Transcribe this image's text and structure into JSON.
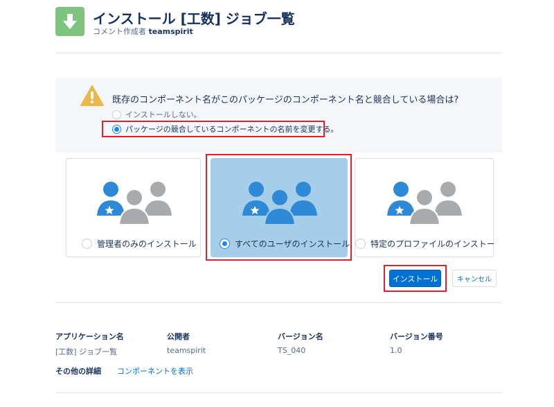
{
  "header": {
    "title": "インストール [工数] ジョブ一覧",
    "subtitle_prefix": "コメント作成者",
    "subtitle_author": "teamspirit"
  },
  "conflict": {
    "question": "既存のコンポーネント名がこのパッケージのコンポーネント名と競合している場合は?",
    "option_no_install": "インストールしない。",
    "option_rename": "パッケージの競合しているコンポーネントの名前を変更する。",
    "selected": "rename"
  },
  "install_options": [
    {
      "label": "管理者のみのインストール",
      "selected": false
    },
    {
      "label": "すべてのユーザのインストール",
      "selected": true
    },
    {
      "label": "特定のプロファイルのインストール...",
      "selected": false
    }
  ],
  "buttons": {
    "install": "インストール",
    "cancel": "キャンセル"
  },
  "details": {
    "columns": [
      {
        "header": "アプリケーション名",
        "value": "[工数] ジョブ一覧"
      },
      {
        "header": "公開者",
        "value": "teamspirit"
      },
      {
        "header": "バージョン名",
        "value": "TS_040"
      },
      {
        "header": "バージョン番号",
        "value": "1.0"
      }
    ],
    "more_label": "その他の詳細",
    "more_link": "コンポーネントを表示"
  },
  "colors": {
    "accent": "#0070d2",
    "app_icon": "#7ec47e",
    "selected_card": "#a6cde9",
    "highlight_box": "#e0202a",
    "warning": "#e8b84d"
  }
}
